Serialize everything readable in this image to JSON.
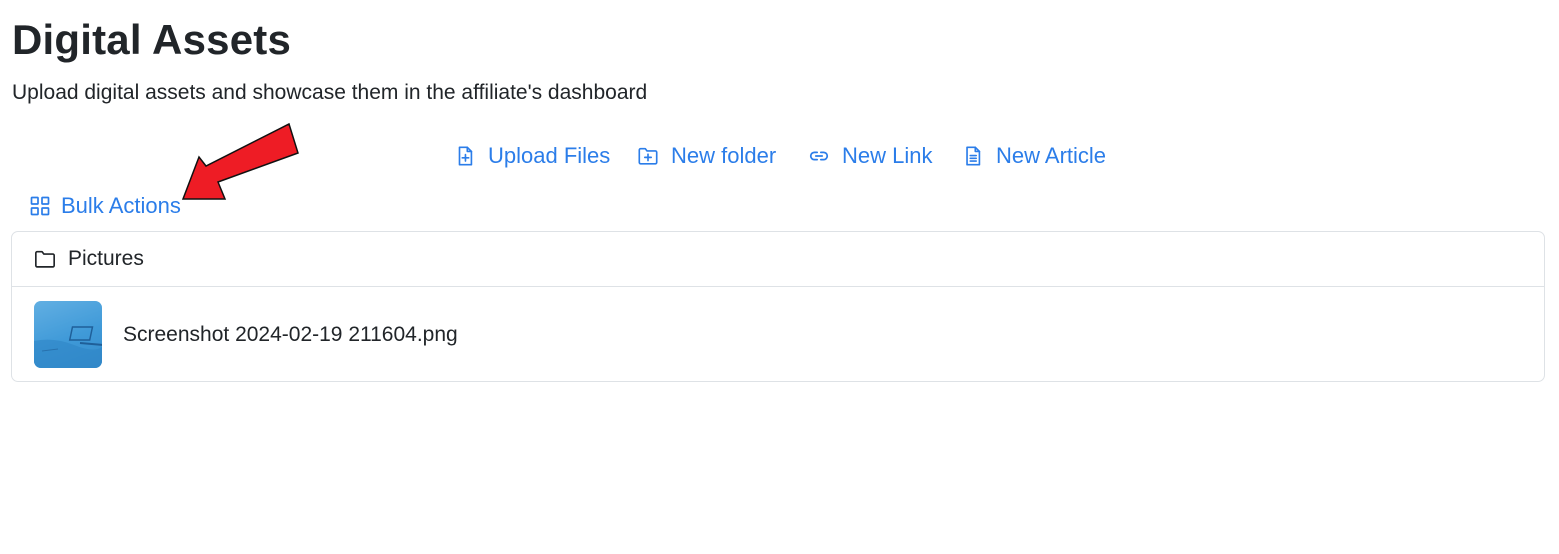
{
  "header": {
    "title": "Digital Assets",
    "subtitle": "Upload digital assets and showcase them in the affiliate's dashboard"
  },
  "toolbar": {
    "upload_files": "Upload Files",
    "new_folder": "New folder",
    "new_link": "New Link",
    "new_article": "New Article"
  },
  "bulk_actions": {
    "label": "Bulk Actions"
  },
  "assets": {
    "folders": [
      {
        "name": "Pictures",
        "icon": "folder-icon"
      }
    ],
    "files": [
      {
        "name": "Screenshot 2024-02-19 211604.png",
        "icon": "image-thumbnail"
      }
    ]
  },
  "colors": {
    "accent": "#2b7de9",
    "text": "#212529",
    "border": "#dee2e6",
    "annotation_arrow": "#ee1c25"
  },
  "annotation": {
    "type": "arrow",
    "points_to": "bulk-actions-button"
  }
}
